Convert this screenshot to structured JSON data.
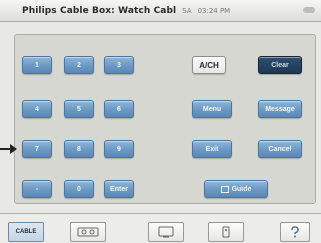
{
  "window": {
    "title": "Philips Cable Box: Watch Cabl",
    "signal_text": "SA",
    "clock_text": "03:24 PM"
  },
  "keypad": {
    "keys": [
      "1",
      "2",
      "3",
      "4",
      "5",
      "6",
      "7",
      "8",
      "9",
      "-",
      "0",
      "Enter"
    ]
  },
  "controls": {
    "ach": "A/CH",
    "clear": "Clear",
    "menu": "Menu",
    "message": "Message",
    "exit": "Exit",
    "cancel": "Cancel",
    "guide": "Guide"
  },
  "tabs": [
    {
      "label": "CABLE",
      "icon": "cable-box-icon",
      "active": true
    },
    {
      "label": "",
      "icon": "vcr-icon",
      "active": false
    },
    {
      "label": "",
      "icon": "tv-icon",
      "active": false
    },
    {
      "label": "",
      "icon": "remote-icon",
      "active": false
    },
    {
      "label": "",
      "icon": "help-icon",
      "active": false
    }
  ],
  "colors": {
    "button_blue": "#6c98c4",
    "button_dark": "#1e3854",
    "panel": "#d7d7d2"
  }
}
